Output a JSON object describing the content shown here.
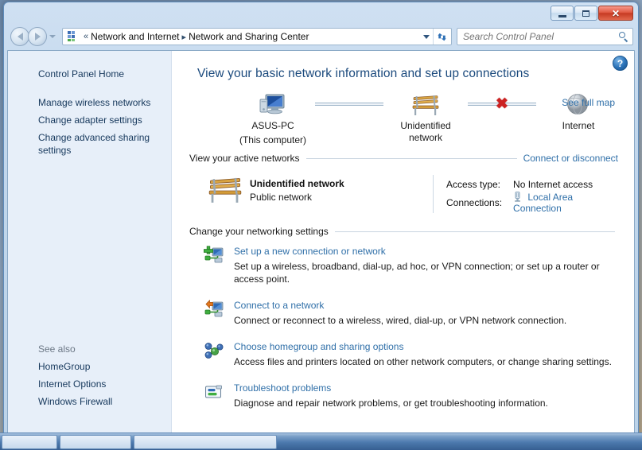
{
  "window": {
    "buttons": {
      "minimize": "Minimize",
      "maximize": "Maximize",
      "close": "✕"
    }
  },
  "navbar": {
    "back_label": "Back",
    "forward_label": "Forward",
    "recent_pages_label": "Recent pages",
    "address_icon": "control-panel-icon",
    "chevron": "«",
    "breadcrumbs": [
      "Network and Internet",
      "Network and Sharing Center"
    ],
    "breadcrumb_separator": "▸",
    "dropdown_label": "Previous locations",
    "refresh_label": "Refresh",
    "search": {
      "placeholder": "Search Control Panel",
      "value": ""
    }
  },
  "sidebar": {
    "home": "Control Panel Home",
    "items": [
      "Manage wireless networks",
      "Change adapter settings",
      "Change advanced sharing settings"
    ],
    "see_also_header": "See also",
    "see_also": [
      "HomeGroup",
      "Internet Options",
      "Windows Firewall"
    ]
  },
  "content": {
    "help_glyph": "?",
    "title": "View your basic network information and set up connections",
    "see_full_map": "See full map",
    "map": {
      "nodes": [
        {
          "icon": "computer-icon",
          "label": "ASUS-PC",
          "sublabel": "(This computer)"
        },
        {
          "icon": "bench-icon",
          "label": "Unidentified network",
          "sublabel": ""
        },
        {
          "icon": "globe-icon",
          "label": "Internet",
          "sublabel": ""
        }
      ],
      "link_broken_glyph": "✖"
    },
    "active_networks": {
      "heading": "View your active networks",
      "action_link": "Connect or disconnect",
      "network_name": "Unidentified network",
      "network_type": "Public network",
      "access_type_label": "Access type:",
      "access_type_value": "No Internet access",
      "connections_label": "Connections:",
      "connection_link": "Local Area Connection",
      "connection_icon": "lan-adapter-icon"
    },
    "settings": {
      "heading": "Change your networking settings",
      "items": [
        {
          "icon": "new-connection-icon",
          "title": "Set up a new connection or network",
          "desc": "Set up a wireless, broadband, dial-up, ad hoc, or VPN connection; or set up a router or access point."
        },
        {
          "icon": "connect-network-icon",
          "title": "Connect to a network",
          "desc": "Connect or reconnect to a wireless, wired, dial-up, or VPN network connection."
        },
        {
          "icon": "homegroup-icon",
          "title": "Choose homegroup and sharing options",
          "desc": "Access files and printers located on other network computers, or change sharing settings."
        },
        {
          "icon": "troubleshoot-icon",
          "title": "Troubleshoot problems",
          "desc": "Diagnose and repair network problems, or get troubleshooting information."
        }
      ]
    }
  },
  "taskbar": {
    "buttons": [
      "",
      "",
      ""
    ]
  },
  "colors": {
    "link": "#2f6fa8",
    "title": "#1b4a7d",
    "sidebar_bg": "#e7eff9",
    "close_red": "#c63a22"
  }
}
